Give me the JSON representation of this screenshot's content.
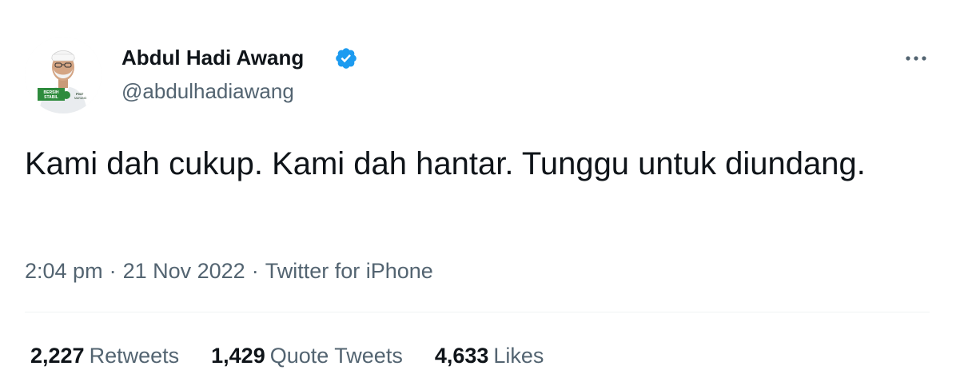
{
  "author": {
    "display_name": "Abdul Hadi Awang",
    "handle": "@abdulhadiawang",
    "verified": true,
    "avatar_banner_text": "BERSIH STABIL",
    "avatar_badge_text": "P037 MARANG"
  },
  "tweet": {
    "text": "Kami dah cukup. Kami dah hantar. Tunggu untuk diundang.",
    "time": "2:04 pm",
    "date": "21 Nov 2022",
    "source": "Twitter for iPhone",
    "separator": "·"
  },
  "stats": {
    "retweets_count": "2,227",
    "retweets_label": "Retweets",
    "quote_count": "1,429",
    "quote_label": "Quote Tweets",
    "likes_count": "4,633",
    "likes_label": "Likes"
  },
  "colors": {
    "verified_blue": "#1d9bf0",
    "secondary_text": "#536471",
    "primary_text": "#0f1419",
    "avatar_green": "#2e8b3d"
  },
  "icons": {
    "verified": "verified-badge-icon",
    "more": "more-options-icon"
  }
}
